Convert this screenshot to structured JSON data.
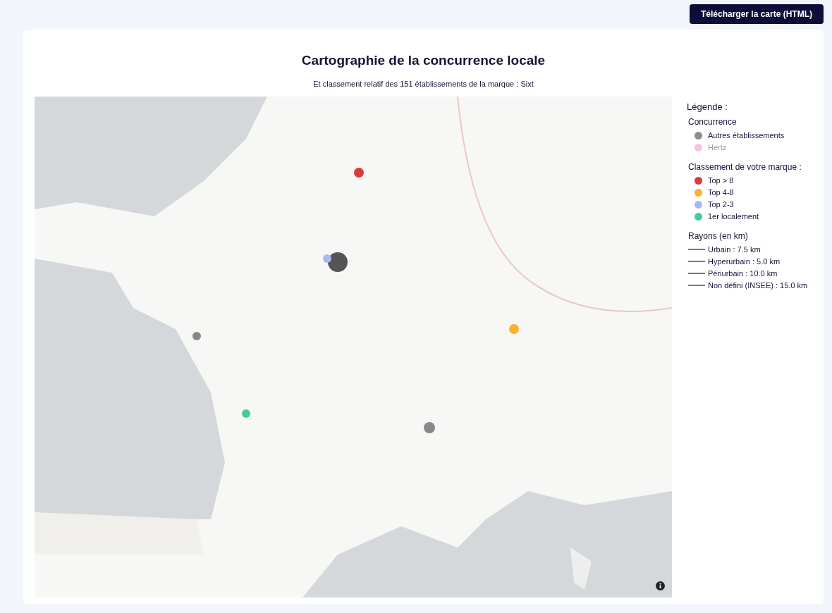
{
  "download_button": "Télécharger la carte (HTML)",
  "title": "Cartographie de la concurrence locale",
  "subtitle": "Et classement relatif des 151 établissements de la marque : Sixt",
  "legend": {
    "title": "Légende :",
    "groups": [
      {
        "title": "Concurrence",
        "items": [
          {
            "kind": "dot",
            "label": "Autres établissements",
            "color": "#8c8c8c",
            "on": true
          },
          {
            "kind": "dot",
            "label": "Hertz",
            "color": "#f0c4e4",
            "on": false
          }
        ]
      },
      {
        "title": "Classement de votre marque :",
        "items": [
          {
            "kind": "dot",
            "label": "Top > 8",
            "color": "#dc3a3a",
            "on": true
          },
          {
            "kind": "dot",
            "label": "Top 4-8",
            "color": "#fbb22c",
            "on": true
          },
          {
            "kind": "dot",
            "label": "Top 2-3",
            "color": "#a9b8f2",
            "on": true
          },
          {
            "kind": "dot",
            "label": "1er localement",
            "color": "#42cc9c",
            "on": true
          }
        ]
      },
      {
        "title": "Rayons (en km)",
        "items": [
          {
            "kind": "line",
            "label": "Urbain : 7.5 km",
            "on": true
          },
          {
            "kind": "line",
            "label": "Hyperurbain : 5.0 km",
            "on": true
          },
          {
            "kind": "line",
            "label": "Périurbain : 10.0 km",
            "on": true
          },
          {
            "kind": "line",
            "label": "Non défini (INSEE) : 15.0 km",
            "on": true
          }
        ]
      }
    ]
  }
}
